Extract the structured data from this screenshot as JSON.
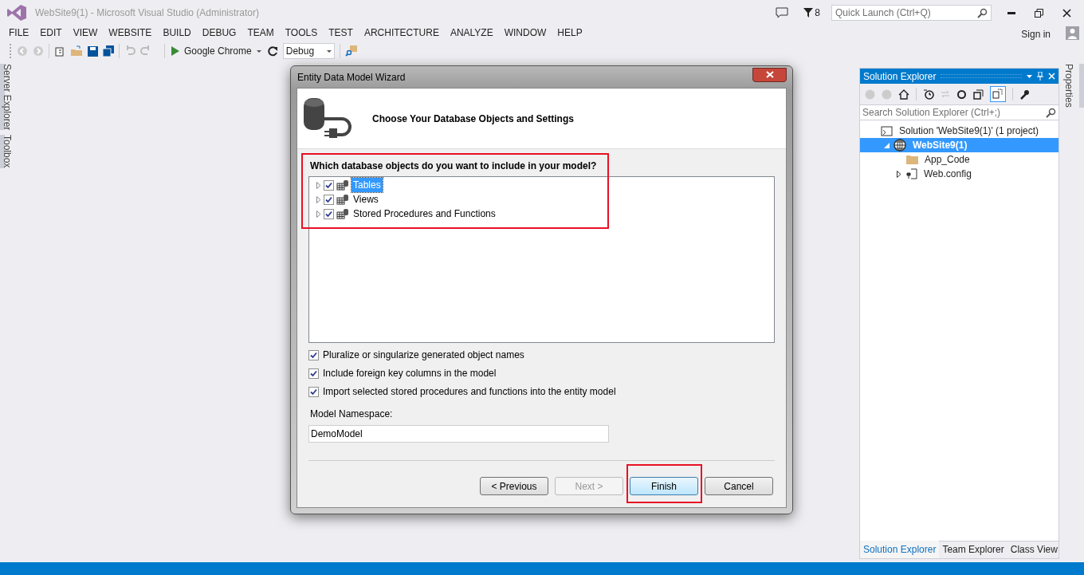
{
  "window": {
    "title": "WebSite9(1) - Microsoft Visual Studio (Administrator)"
  },
  "notifications": {
    "count": "8"
  },
  "quick_launch": {
    "placeholder": "Quick Launch (Ctrl+Q)"
  },
  "menu": [
    "FILE",
    "EDIT",
    "VIEW",
    "WEBSITE",
    "BUILD",
    "DEBUG",
    "TEAM",
    "TOOLS",
    "TEST",
    "ARCHITECTURE",
    "ANALYZE",
    "WINDOW",
    "HELP"
  ],
  "sign_in": "Sign in",
  "toolbar": {
    "browser": "Google Chrome",
    "configuration": "Debug"
  },
  "left_tabs": [
    "Server Explorer",
    "Toolbox"
  ],
  "right_tabs": [
    "Properties"
  ],
  "dialog": {
    "title": "Entity Data Model Wizard",
    "heading": "Choose Your Database Objects and Settings",
    "question": "Which database objects do you want to include in your model?",
    "objects": [
      {
        "label": "Tables",
        "checked": true,
        "selected": true
      },
      {
        "label": "Views",
        "checked": true,
        "selected": false
      },
      {
        "label": "Stored Procedures and Functions",
        "checked": true,
        "selected": false
      }
    ],
    "options": [
      {
        "label": "Pluralize or singularize generated object names",
        "checked": true
      },
      {
        "label": "Include foreign key columns in the model",
        "checked": true
      },
      {
        "label": "Import selected stored procedures and functions into the entity model",
        "checked": true
      }
    ],
    "namespace_label": "Model Namespace:",
    "namespace_value": "DemoModel",
    "buttons": [
      {
        "label": "< Previous",
        "disabled": false,
        "default": false
      },
      {
        "label": "Next >",
        "disabled": true,
        "default": false
      },
      {
        "label": "Finish",
        "disabled": false,
        "default": true
      },
      {
        "label": "Cancel",
        "disabled": false,
        "default": false
      }
    ]
  },
  "solution_explorer": {
    "title": "Solution Explorer",
    "search_placeholder": "Search Solution Explorer (Ctrl+;)",
    "tree": [
      {
        "label": "Solution 'WebSite9(1)' (1 project)",
        "kind": "solution",
        "selected": false,
        "children": [
          {
            "label": "WebSite9(1)",
            "kind": "website",
            "selected": true,
            "expanded": true,
            "children": [
              {
                "label": "App_Code",
                "kind": "folder",
                "selected": false
              },
              {
                "label": "Web.config",
                "kind": "config",
                "selected": false,
                "expanded": false
              }
            ]
          }
        ]
      }
    ],
    "tabs": [
      {
        "label": "Solution Explorer",
        "selected": true
      },
      {
        "label": "Team Explorer",
        "selected": false
      },
      {
        "label": "Class View",
        "selected": false
      }
    ]
  }
}
